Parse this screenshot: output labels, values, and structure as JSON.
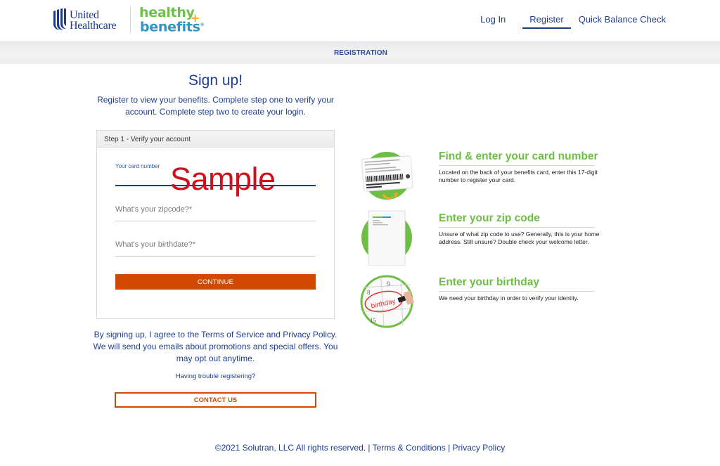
{
  "header": {
    "brand_primary": "United Healthcare",
    "brand_primary_line1": "United",
    "brand_primary_line2": "Healthcare",
    "brand_secondary_line1": "healthy",
    "brand_secondary_line2": "benefits",
    "brand_secondary_plus": "+",
    "nav": [
      {
        "label": "Log In",
        "active": false
      },
      {
        "label": "Register",
        "active": true
      },
      {
        "label": "Quick Balance Check",
        "active": false
      }
    ]
  },
  "subbar": {
    "label": "REGISTRATION"
  },
  "signup": {
    "title": "Sign up!",
    "intro": "Register to view your benefits. Complete step one to verify your account. Complete step two to create your login."
  },
  "form": {
    "step_header": "Step 1 - Verify your account",
    "card_number_label": "Your card number",
    "card_number_value": "",
    "watermark": "Sample",
    "zip_placeholder": "What's your zipcode?*",
    "zip_value": "",
    "birthdate_placeholder": "What's your birthdate?*",
    "birthdate_value": "",
    "continue_label": "CONTINUE"
  },
  "agreement": {
    "text": "By signing up, I agree to the Terms of Service and Privacy Policy. We will send you emails about promotions and special offers. You may opt out anytime.",
    "trouble_link": "Having trouble registering?",
    "contact_label": "CONTACT US"
  },
  "steps": [
    {
      "icon": "benefits-card-icon",
      "title": "Find & enter your card number",
      "description": "Located on the back of your benefits card, enter this 17-digit number to register your card."
    },
    {
      "icon": "welcome-letter-icon",
      "title": "Enter your zip code",
      "description": "Unsure of what zip code to use? Generally, this is your home address. Still unsure? Double check your welcome letter."
    },
    {
      "icon": "calendar-birthday-icon",
      "title": "Enter your birthday",
      "description": "We need your birthday in order to verify your identity."
    }
  ],
  "footer": {
    "copyright": "©2021 Solutran, LLC All rights reserved.",
    "separator": "|",
    "terms": "Terms & Conditions",
    "privacy": "Privacy Policy"
  },
  "colors": {
    "brand_blue": "#1d3d8f",
    "accent_orange": "#d04a02",
    "step_green": "#6ebe44",
    "watermark_red": "#d0101a"
  }
}
